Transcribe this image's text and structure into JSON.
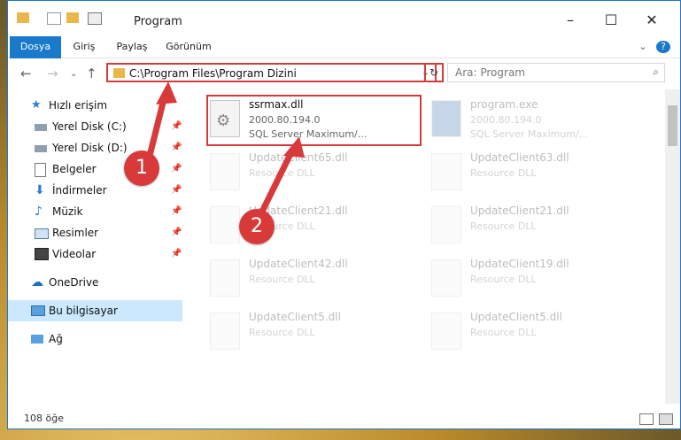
{
  "window": {
    "title": "Program"
  },
  "ribbon": {
    "tabs": [
      "Dosya",
      "Giriş",
      "Paylaş",
      "Görünüm"
    ]
  },
  "address": {
    "path": "C:\\Program Files\\Program Dizini"
  },
  "search": {
    "placeholder": "Ara: Program"
  },
  "sidebar": {
    "items": [
      {
        "label": "Hızlı erişim",
        "icon": "star-icon",
        "pinned": false
      },
      {
        "label": "Yerel Disk (C:)",
        "icon": "drive-icon",
        "pinned": true
      },
      {
        "label": "Yerel Disk (D:)",
        "icon": "drive-icon",
        "pinned": true
      },
      {
        "label": "Belgeler",
        "icon": "documents-icon",
        "pinned": true
      },
      {
        "label": "İndirmeler",
        "icon": "download-icon",
        "pinned": true
      },
      {
        "label": "Müzik",
        "icon": "music-icon",
        "pinned": true
      },
      {
        "label": "Resimler",
        "icon": "pictures-icon",
        "pinned": true
      },
      {
        "label": "Videolar",
        "icon": "video-icon",
        "pinned": true
      },
      {
        "label": "OneDrive",
        "icon": "cloud-icon",
        "pinned": false
      },
      {
        "label": "Bu bilgisayar",
        "icon": "computer-icon",
        "pinned": false
      },
      {
        "label": "Ağ",
        "icon": "network-icon",
        "pinned": false
      }
    ]
  },
  "files": [
    {
      "name": "ssrmax.dll",
      "line2": "2000.80.194.0",
      "line3": "SQL Server Maximum/..."
    },
    {
      "name": "program.exe",
      "line2": "2000.80.194.0",
      "line3": "SQL Server Maximum/..."
    },
    {
      "name": "UpdateClient65.dll",
      "line2": "Resource DLL",
      "line3": ""
    },
    {
      "name": "UpdateClient63.dll",
      "line2": "Resource DLL",
      "line3": ""
    },
    {
      "name": "UpdateClient21.dll",
      "line2": "Resource DLL",
      "line3": ""
    },
    {
      "name": "UpdateClient21.dll",
      "line2": "Resource DLL",
      "line3": ""
    },
    {
      "name": "UpdateClient42.dll",
      "line2": "Resource DLL",
      "line3": ""
    },
    {
      "name": "UpdateClient19.dll",
      "line2": "Resource DLL",
      "line3": ""
    },
    {
      "name": "UpdateClient5.dll",
      "line2": "Resource DLL",
      "line3": ""
    },
    {
      "name": "UpdateClient5.dll",
      "line2": "Resource DLL",
      "line3": ""
    }
  ],
  "status": {
    "count": "108 öğe"
  },
  "badges": {
    "one": "1",
    "two": "2"
  },
  "colors": {
    "accent": "#1979ca",
    "highlight": "#d63b3b"
  }
}
